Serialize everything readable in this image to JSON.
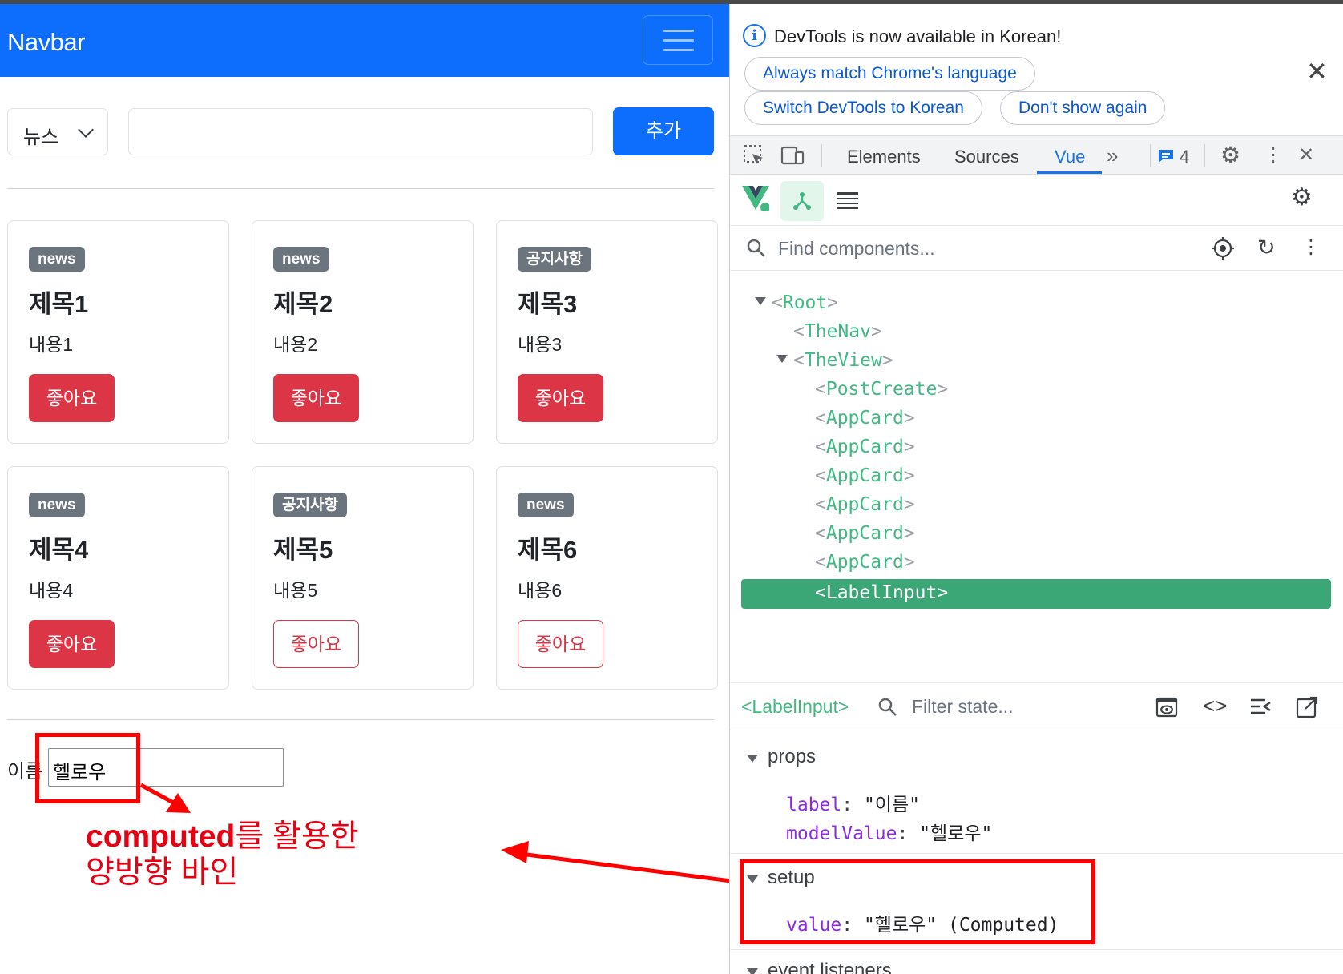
{
  "navbar": {
    "brand": "Navbar"
  },
  "post_create": {
    "select_value": "뉴스",
    "title_placeholder": "",
    "add_label": "추가"
  },
  "cards": [
    {
      "badge": "news",
      "title": "제목1",
      "content": "내용1",
      "like_label": "좋아요",
      "liked": true
    },
    {
      "badge": "news",
      "title": "제목2",
      "content": "내용2",
      "like_label": "좋아요",
      "liked": true
    },
    {
      "badge": "공지사항",
      "title": "제목3",
      "content": "내용3",
      "like_label": "좋아요",
      "liked": true
    },
    {
      "badge": "news",
      "title": "제목4",
      "content": "내용4",
      "like_label": "좋아요",
      "liked": true
    },
    {
      "badge": "공지사항",
      "title": "제목5",
      "content": "내용5",
      "like_label": "좋아요",
      "liked": false
    },
    {
      "badge": "news",
      "title": "제목6",
      "content": "내용6",
      "like_label": "좋아요",
      "liked": false
    }
  ],
  "label_input": {
    "label": "이름",
    "value": "헬로우"
  },
  "annotation": {
    "bold": "computed",
    "line1_rest": "를 활용한",
    "line2": "양방향 바인"
  },
  "devtools": {
    "notice": {
      "message": "DevTools is now available in Korean!",
      "btn_match": "Always match Chrome's language",
      "btn_switch": "Switch DevTools to Korean",
      "btn_dont": "Don't show again"
    },
    "tabs": [
      "Elements",
      "Sources",
      "Vue"
    ],
    "active_tab": "Vue",
    "issues_count": "4",
    "find_placeholder": "Find components...",
    "tree": [
      {
        "name": "Root"
      },
      {
        "name": "TheNav"
      },
      {
        "name": "TheView"
      },
      {
        "name": "PostCreate"
      },
      {
        "name": "AppCard"
      },
      {
        "name": "AppCard"
      },
      {
        "name": "AppCard"
      },
      {
        "name": "AppCard"
      },
      {
        "name": "AppCard"
      },
      {
        "name": "AppCard"
      },
      {
        "name": "LabelInput"
      }
    ],
    "state": {
      "component": "<LabelInput>",
      "filter_placeholder": "Filter state...",
      "props_title": "props",
      "props": [
        {
          "key": "label",
          "value": "\"이름\""
        },
        {
          "key": "modelValue",
          "value": "\"헬로우\""
        }
      ],
      "setup_title": "setup",
      "setup": [
        {
          "key": "value",
          "value": "\"헬로우\" (Computed)"
        }
      ],
      "events_title": "event listeners"
    }
  },
  "colors": {
    "primary": "#0d6efd",
    "danger": "#dc3545",
    "badge": "#6c757d",
    "vue_green": "#42b883",
    "annotation_red": "#ff0000"
  }
}
